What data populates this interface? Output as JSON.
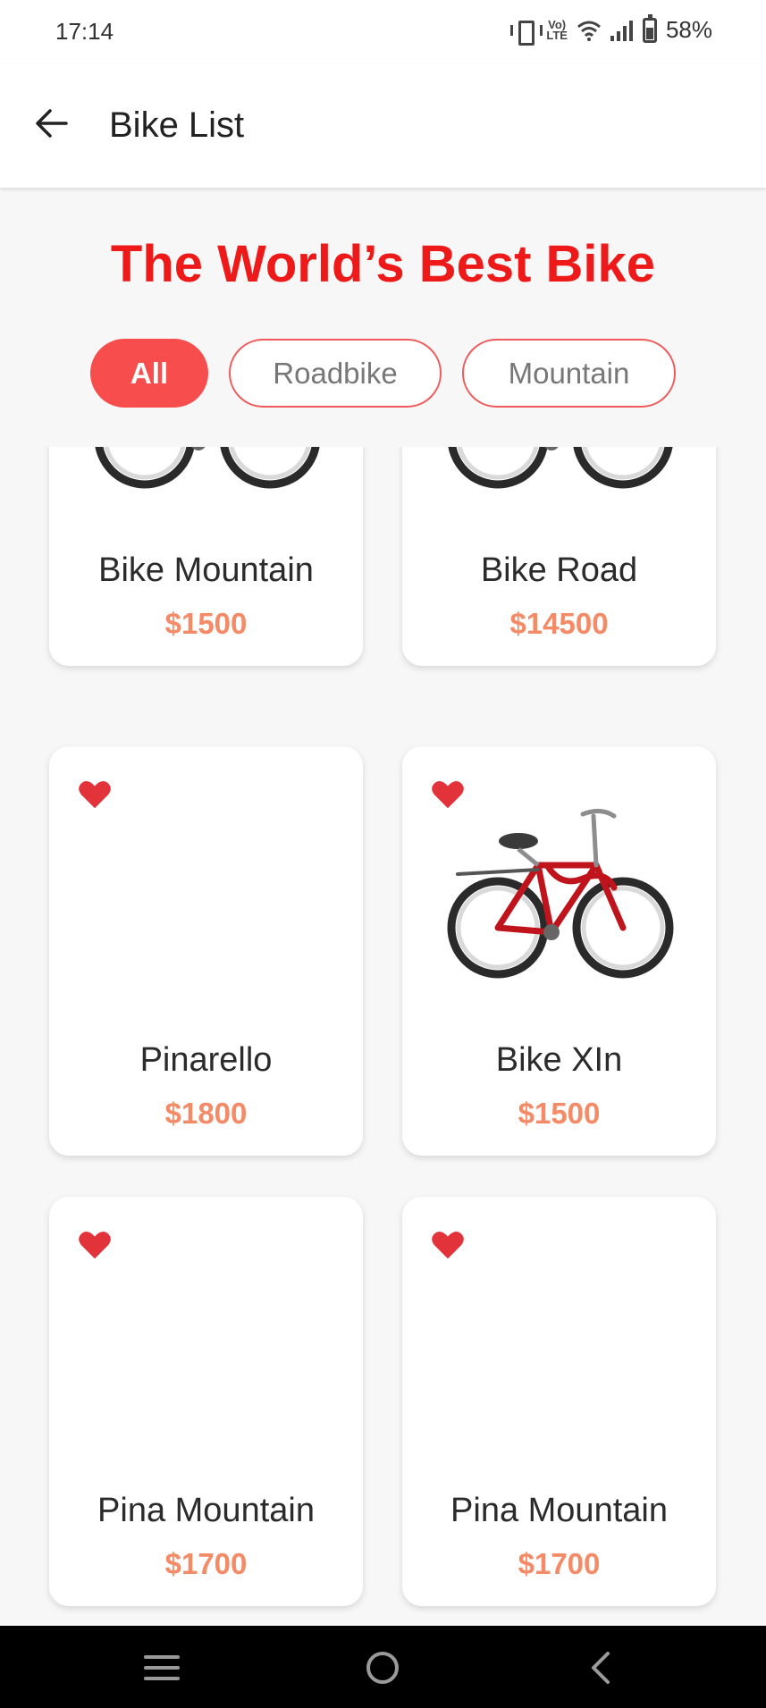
{
  "status_bar": {
    "time": "17:14",
    "volte": "Vol LTE",
    "battery": "58%"
  },
  "app_bar": {
    "title": "Bike List"
  },
  "hero": {
    "title": "The World’s Best Bike"
  },
  "filters": [
    {
      "label": "All",
      "selected": true
    },
    {
      "label": "Roadbike",
      "selected": false
    },
    {
      "label": "Mountain",
      "selected": false
    }
  ],
  "products": [
    {
      "name": "Bike Mountain",
      "price": "$1500",
      "has_image": true,
      "favorite_icon": "heart-icon"
    },
    {
      "name": "Bike Road",
      "price": "$14500",
      "has_image": true,
      "favorite_icon": "heart-icon"
    },
    {
      "name": "Pinarello",
      "price": "$1800",
      "has_image": false,
      "favorite_icon": "heart-icon"
    },
    {
      "name": "Bike XIn",
      "price": "$1500",
      "has_image": true,
      "favorite_icon": "heart-icon"
    },
    {
      "name": "Pina Mountain",
      "price": "$1700",
      "has_image": false,
      "favorite_icon": "heart-icon"
    },
    {
      "name": "Pina Mountain",
      "price": "$1700",
      "has_image": false,
      "favorite_icon": "heart-icon"
    }
  ],
  "colors": {
    "accent_red": "#ee1a1a",
    "chip_red": "#f74d4d",
    "price": "#f48a66",
    "bike_red": "#c0141c"
  }
}
